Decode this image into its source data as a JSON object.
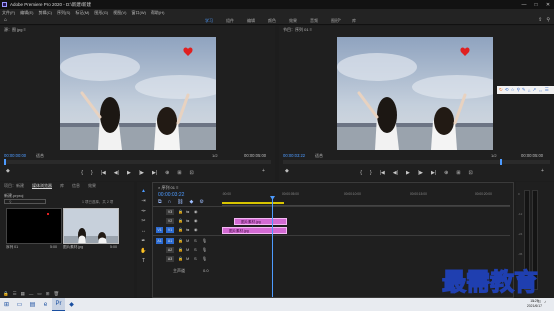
{
  "window": {
    "title": "Adobe Premiere Pro 2020 - D:\\新建\\新建",
    "controls": [
      "—",
      "□",
      "✕"
    ]
  },
  "menu": [
    "文件(F)",
    "编辑(E)",
    "剪辑(C)",
    "序列(S)",
    "标记(M)",
    "图形(G)",
    "视图(V)",
    "窗口(W)",
    "帮助(H)"
  ],
  "workspaces": {
    "tabs": [
      "学习",
      "组件",
      "编辑",
      "颜色",
      "效果",
      "音频",
      "图形",
      "库"
    ],
    "active_index": 0,
    "more": "»"
  },
  "source_monitor": {
    "title": "源：图 jpg ≡",
    "timecode": "00:00:00:00",
    "fit": "适合",
    "fraction": "1/2",
    "duration": "00:00:05:00",
    "playhead_fraction": 0.0
  },
  "program_monitor": {
    "title": "节目：序列 01 ≡",
    "timecode": "00:00:03:22",
    "fit": "适合",
    "fraction": "1/2",
    "duration": "00:00:05:00",
    "playhead_fraction": 0.82
  },
  "transport_icons": [
    "{",
    "}",
    "|◀",
    "◀|",
    "▶",
    "|▶",
    "▶|",
    "⊕",
    "⊞",
    "⊡"
  ],
  "float_toolbar": {
    "icons": [
      "↻",
      "⟲",
      "☆",
      "⚲",
      "✎",
      "⌂",
      "↗",
      "⇔",
      "☰"
    ],
    "accent": "#f06b1f"
  },
  "project": {
    "tabs": [
      "项目：新建",
      "媒体浏览器",
      "库",
      "信息",
      "效果"
    ],
    "active_tab": 1,
    "path": "新建.prproj",
    "search_placeholder": "",
    "count": "1 项已选择，共 2 项",
    "items": [
      {
        "label": "序列 01",
        "duration": "5:00"
      },
      {
        "label": "图片素材.jpg",
        "duration": "5:00"
      }
    ]
  },
  "timeline": {
    "title": "× 序列 01 ≡",
    "timecode": "00:00:03:22",
    "ruler_ticks": [
      ":00:00",
      "00:00:05:00",
      "00:00:10:00",
      "00:00:15:00",
      "00:00:20:00"
    ],
    "tracks": [
      {
        "target": "",
        "label": "V3"
      },
      {
        "target": "",
        "label": "V2"
      },
      {
        "target": "V1",
        "label": "V1"
      },
      {
        "target": "A1",
        "label": "A1"
      },
      {
        "target": "",
        "label": "A2"
      },
      {
        "target": "",
        "label": "A3"
      }
    ],
    "clips": [
      {
        "name": "图片素材.jpg",
        "track": "V2"
      },
      {
        "name": "图片素材.jpg",
        "track": "V1"
      }
    ],
    "master": "主声道",
    "master_value": "0.0"
  },
  "meter_scale": [
    "0",
    "-12",
    "-24",
    "-36",
    "-48",
    "dB"
  ],
  "taskbar": {
    "clock_time": "15:29",
    "clock_date": "2021/6/17"
  },
  "watermark": "最需教育"
}
